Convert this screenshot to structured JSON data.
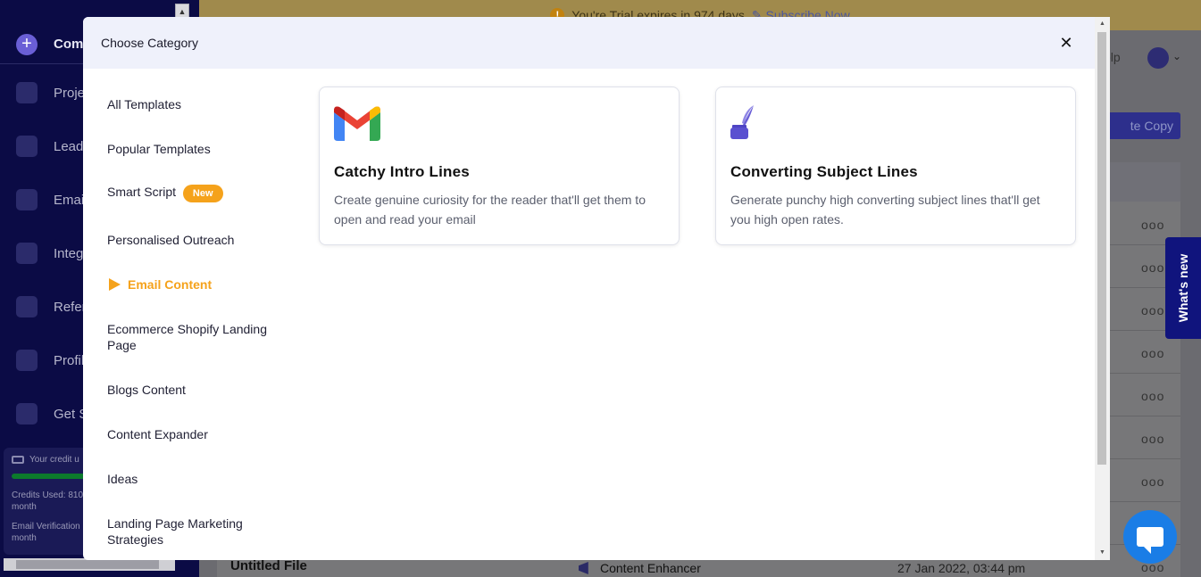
{
  "background": {
    "sidebar": {
      "compose_label": "Com",
      "items": [
        {
          "label": "Proje",
          "icon": "folder-icon"
        },
        {
          "label": "Lead",
          "icon": "lead-icon"
        },
        {
          "label": "Emai",
          "icon": "bolt-icon"
        },
        {
          "label": "Integ",
          "icon": "puzzle-icon"
        },
        {
          "label": "Refer",
          "icon": "refer-icon"
        },
        {
          "label": "Profil",
          "icon": "user-icon"
        },
        {
          "label": "Get S",
          "icon": "rocket-icon"
        }
      ],
      "credit": {
        "header": "Your credit u",
        "line1": "Credits Used: 810",
        "line1b": "month",
        "line2": "Email Verification",
        "line2b": "month"
      }
    },
    "trial_bar": {
      "text": "You're Trial expires in 974 days",
      "link": "Subscribe Now",
      "accent": "#c2820f"
    },
    "header": {
      "help": "elp"
    },
    "copy_button": "te Copy",
    "row_dots": "ooo",
    "last_row": {
      "title": "Untitled File",
      "type": "Content Enhancer",
      "date": "27 Jan 2022, 03:44 pm"
    },
    "whats_new": "What's new"
  },
  "modal": {
    "title": "Choose Category",
    "close_icon": "close-icon",
    "categories": [
      {
        "label": "All Templates"
      },
      {
        "label": "Popular Templates"
      },
      {
        "label": "Smart Script",
        "badge": "New"
      },
      {
        "label": "Personalised Outreach"
      },
      {
        "label": "Email Content",
        "active": true
      },
      {
        "label": "Ecommerce Shopify Landing Page"
      },
      {
        "label": "Blogs Content"
      },
      {
        "label": "Content Expander"
      },
      {
        "label": "Ideas"
      },
      {
        "label": "Landing Page Marketing Strategies"
      }
    ],
    "templates": [
      {
        "icon": "gmail-icon",
        "title": "Catchy Intro Lines",
        "description": "Create genuine curiosity for the reader that'll get them to open and read your email"
      },
      {
        "icon": "quill-ink-icon",
        "title": "Converting Subject Lines",
        "description": "Generate punchy high converting subject lines that'll get you high open rates."
      }
    ],
    "accent_color": "#f5a21b"
  }
}
